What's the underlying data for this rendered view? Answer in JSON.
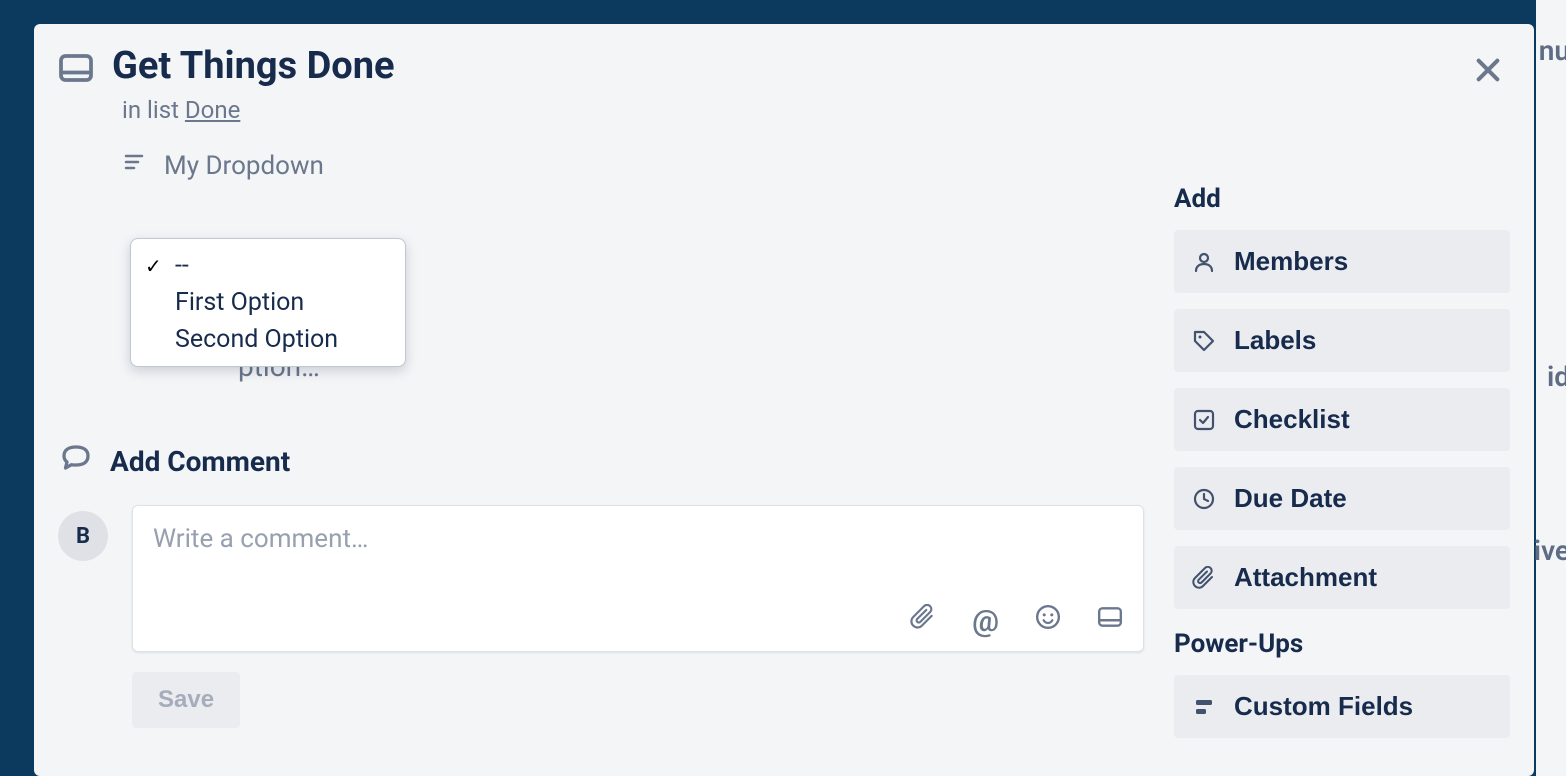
{
  "card": {
    "title": "Get Things Done",
    "in_list_prefix": "in list ",
    "list_name": "Done"
  },
  "customField": {
    "label": "My Dropdown",
    "options": [
      {
        "label": "--",
        "selected": true
      },
      {
        "label": "First Option",
        "selected": false
      },
      {
        "label": "Second Option",
        "selected": false
      }
    ]
  },
  "description": {
    "edit_link": "Edit the description…"
  },
  "comment": {
    "section_title": "Add Comment",
    "avatar_initial": "B",
    "placeholder": "Write a comment…",
    "save_label": "Save"
  },
  "sidebar": {
    "add_title": "Add",
    "buttons": [
      {
        "label": "Members"
      },
      {
        "label": "Labels"
      },
      {
        "label": "Checklist"
      },
      {
        "label": "Due Date"
      },
      {
        "label": "Attachment"
      }
    ],
    "powerups_title": "Power-Ups",
    "powerups": [
      {
        "label": "Custom Fields"
      }
    ]
  }
}
